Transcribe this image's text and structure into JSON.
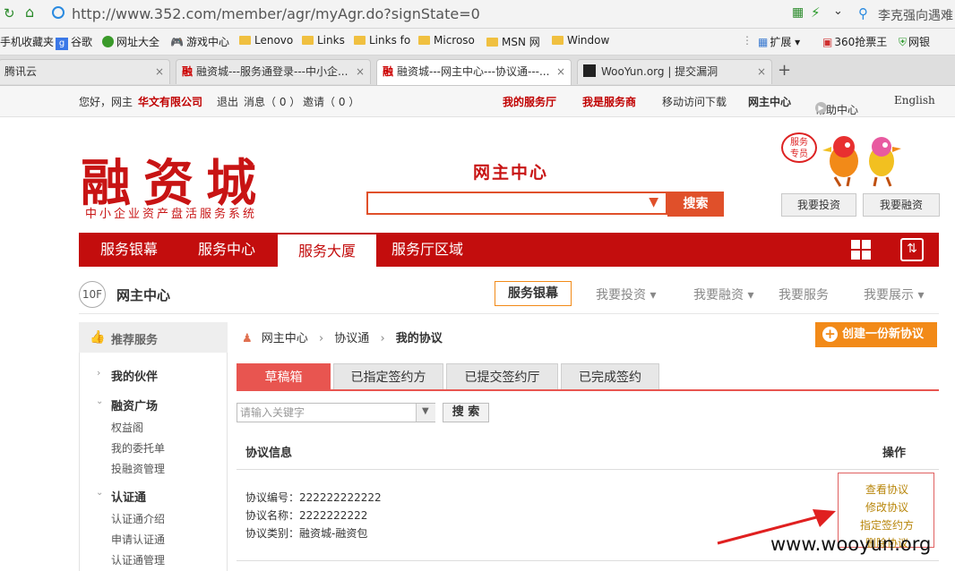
{
  "browser": {
    "url": "http://www.352.com/member/agr/myAgr.do?signState=0",
    "right_search": "李克强向遇难",
    "bookmarks": [
      "手机收藏夹",
      "谷歌",
      "网址大全",
      "游戏中心",
      "Lenovo",
      "Links",
      "Links fo",
      "Microso",
      "MSN 网",
      "Window"
    ],
    "bookmarks_right": [
      "扩展",
      "360抢票王",
      "网银"
    ],
    "tabs": [
      {
        "label": "腾讯云"
      },
      {
        "label": "融资城---服务通登录---中小企..."
      },
      {
        "label": "融资城---网主中心---协议通---..."
      },
      {
        "label": "WooYun.org | 提交漏洞"
      }
    ]
  },
  "topbar": {
    "greeting": "您好，网主",
    "company": "华文有限公司",
    "logout": "退出",
    "messages": "消息（ 0 ）",
    "invites": "邀请（ 0 ）",
    "links": [
      "我的服务厅",
      "我是服务商",
      "移动访问下载",
      "网主中心",
      "帮助中心",
      "English"
    ]
  },
  "header": {
    "logo": "融资城",
    "logo_sub": "中小企业资产盘活服务系统",
    "center_title": "网主中心",
    "search_button": "搜索",
    "mascot_badge": "服务专员",
    "invest_button": "我要投资",
    "finance_button": "我要融资"
  },
  "nav": {
    "items": [
      "服务银幕",
      "服务中心",
      "服务大厦",
      "服务厅区域"
    ]
  },
  "floor": {
    "badge": "10F",
    "title": "网主中心",
    "active": "服务银幕",
    "menus": [
      "我要投资",
      "我要融资",
      "我要服务",
      "我要展示"
    ]
  },
  "sidebar": {
    "head": "推荐服务",
    "sections": [
      {
        "title": "我的伙伴",
        "items": []
      },
      {
        "title": "融资广场",
        "items": [
          "权益阁",
          "我的委托单",
          "投融资管理"
        ]
      },
      {
        "title": "认证通",
        "items": [
          "认证通介绍",
          "申请认证通",
          "认证通管理"
        ]
      }
    ]
  },
  "content": {
    "breadcrumb": [
      "网主中心",
      "协议通",
      "我的协议"
    ],
    "create_button": "创建一份新协议",
    "tabs": [
      "草稿箱",
      "已指定签约方",
      "已提交签约厅",
      "已完成签约"
    ],
    "keyword_placeholder": "请输入关键字",
    "search_button": "搜 索",
    "table_header": {
      "info": "协议信息",
      "ops": "操作"
    },
    "row": {
      "number": "协议编号：222222222222",
      "name": "协议名称：2222222222",
      "type": "协议类别：融资城-融资包"
    },
    "ops": [
      "查看协议",
      "修改协议",
      "指定签约方",
      "删除协议"
    ]
  },
  "watermark": "www.wooyun.org"
}
